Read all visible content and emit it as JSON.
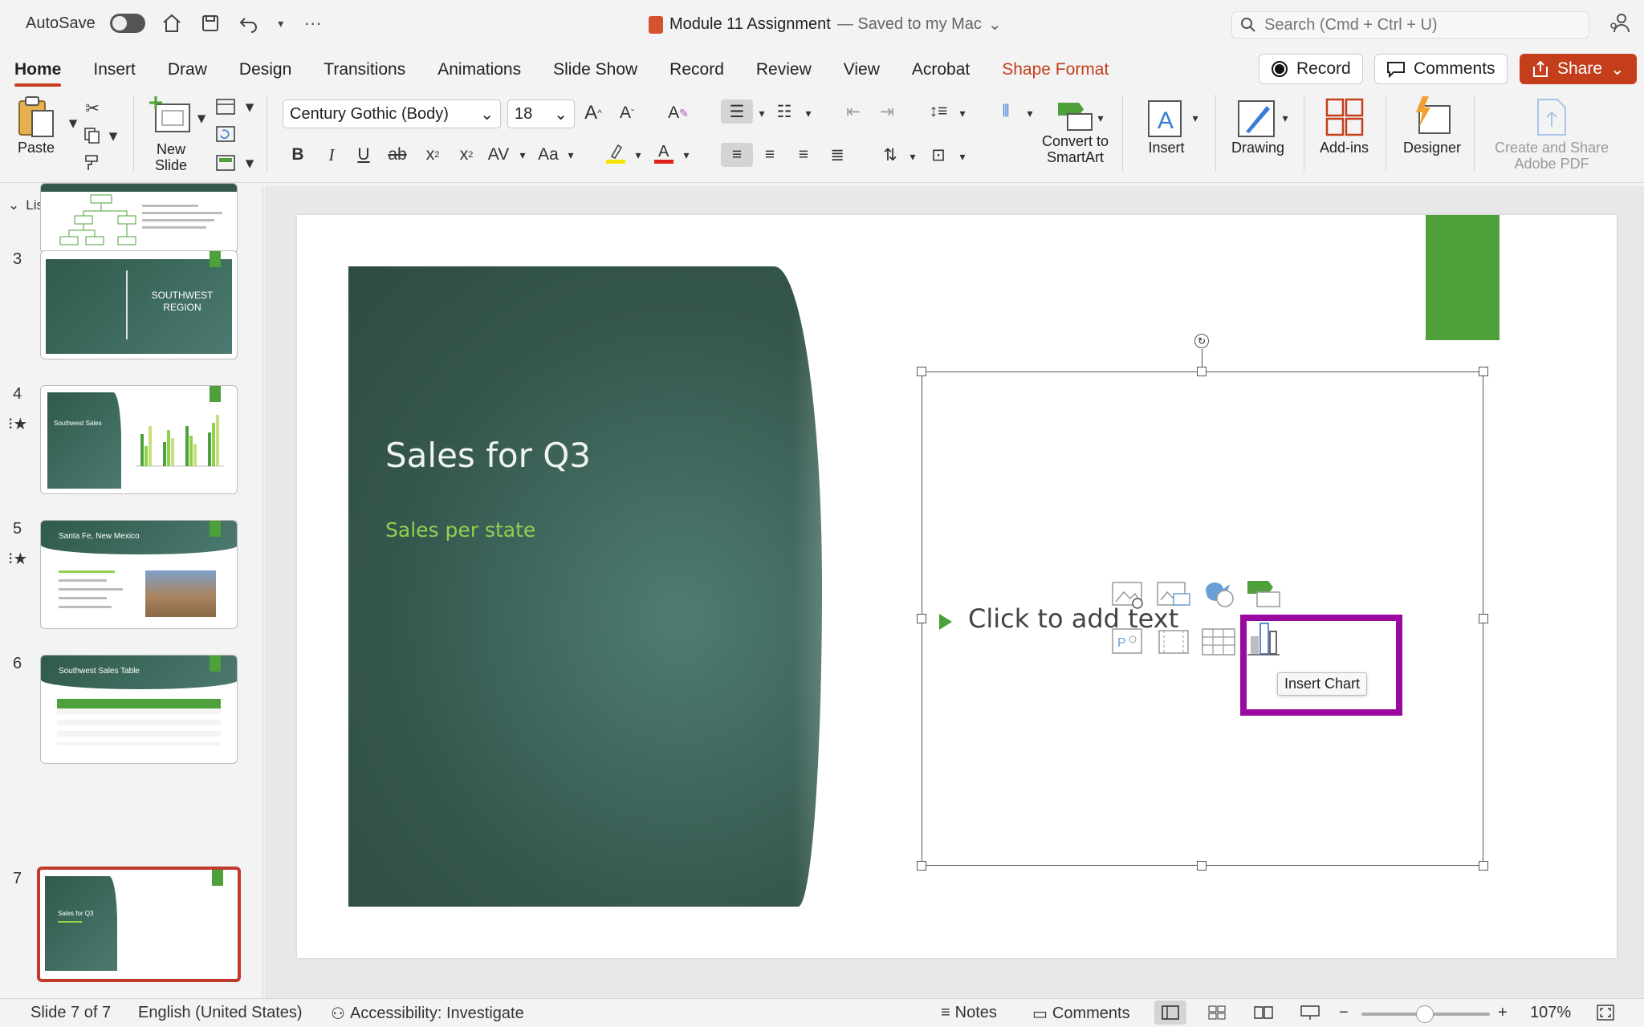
{
  "titlebar": {
    "autosave_label": "AutoSave",
    "doc_name": "Module 11 Assignment",
    "doc_status": "— Saved to my Mac",
    "search_placeholder": "Search (Cmd + Ctrl + U)"
  },
  "tabs": [
    "Home",
    "Insert",
    "Draw",
    "Design",
    "Transitions",
    "Animations",
    "Slide Show",
    "Record",
    "Review",
    "View",
    "Acrobat",
    "Shape Format"
  ],
  "tab_buttons": {
    "record": "Record",
    "comments": "Comments",
    "share": "Share"
  },
  "ribbon": {
    "paste": "Paste",
    "new_slide_line1": "New",
    "new_slide_line2": "Slide",
    "font_name": "Century Gothic (Body)",
    "font_size": "18",
    "convert_line1": "Convert to",
    "convert_line2": "SmartArt",
    "insert": "Insert",
    "drawing": "Drawing",
    "addins": "Add-ins",
    "designer": "Designer",
    "adobe_line1": "Create and Share",
    "adobe_line2": "Adobe PDF"
  },
  "pane": {
    "header": "List",
    "slides": [
      {
        "num": "3",
        "text": "SOUTHWEST REGION"
      },
      {
        "num": "4",
        "text": "Southwest Sales"
      },
      {
        "num": "5",
        "text": "Santa Fe, New Mexico"
      },
      {
        "num": "6",
        "text": "Southwest Sales Table"
      },
      {
        "num": "7",
        "text": "Sales for Q3"
      }
    ]
  },
  "slide": {
    "title": "Sales for Q3",
    "subtitle": "Sales per state",
    "placeholder_text": "Click to add text",
    "tooltip": "Insert Chart"
  },
  "status": {
    "slide_pos": "Slide 7 of 7",
    "language": "English (United States)",
    "accessibility": "Accessibility: Investigate",
    "notes": "Notes",
    "comments": "Comments",
    "zoom": "107%"
  },
  "colors": {
    "accent": "#c43e1c",
    "slide_green": "#4ea03a",
    "highlight": "#9b0aa0"
  }
}
